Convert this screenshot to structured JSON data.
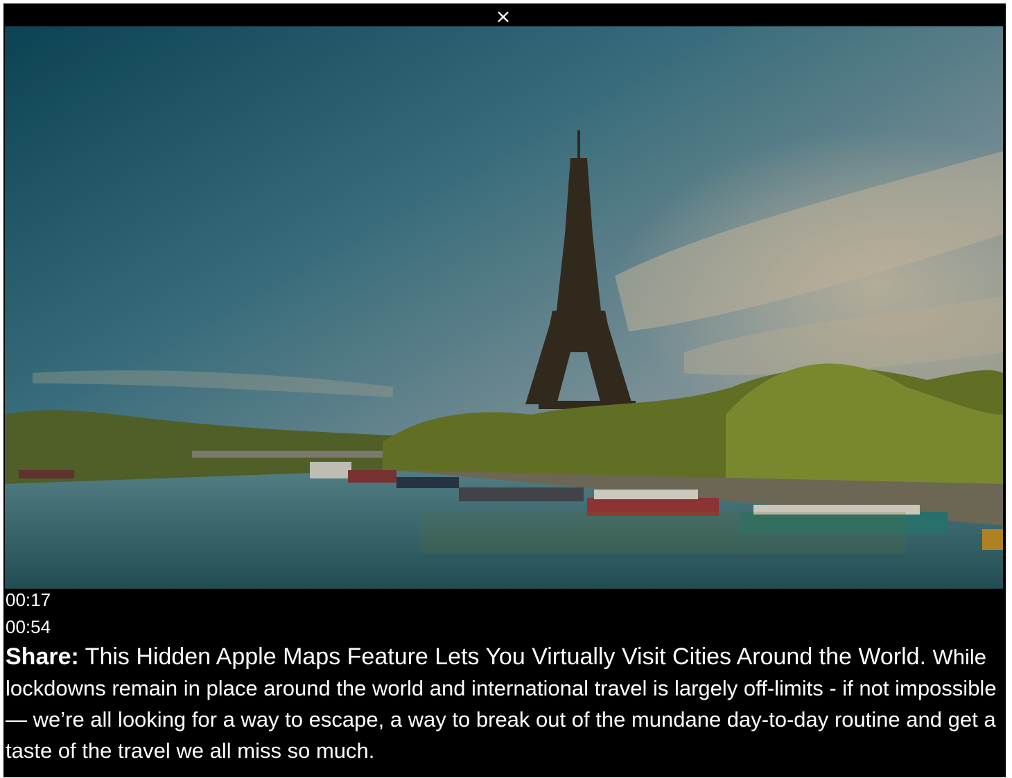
{
  "player": {
    "close_glyph": "×",
    "current_time": "00:17",
    "duration": "00:54",
    "image_subject": "eiffel-tower-seine-river",
    "scrim_color": "#000000"
  },
  "caption": {
    "share_label": "Share:",
    "title": "This Hidden Apple Maps Feature Lets You Virtually Visit Cities Around the World.",
    "body": "While lockdowns remain in place around the world and international travel is largely off-limits - if not impossible — we’re all looking for a way to escape, a way to break out of the mundane day-to-day routine and get a taste of the travel we all miss so much."
  }
}
